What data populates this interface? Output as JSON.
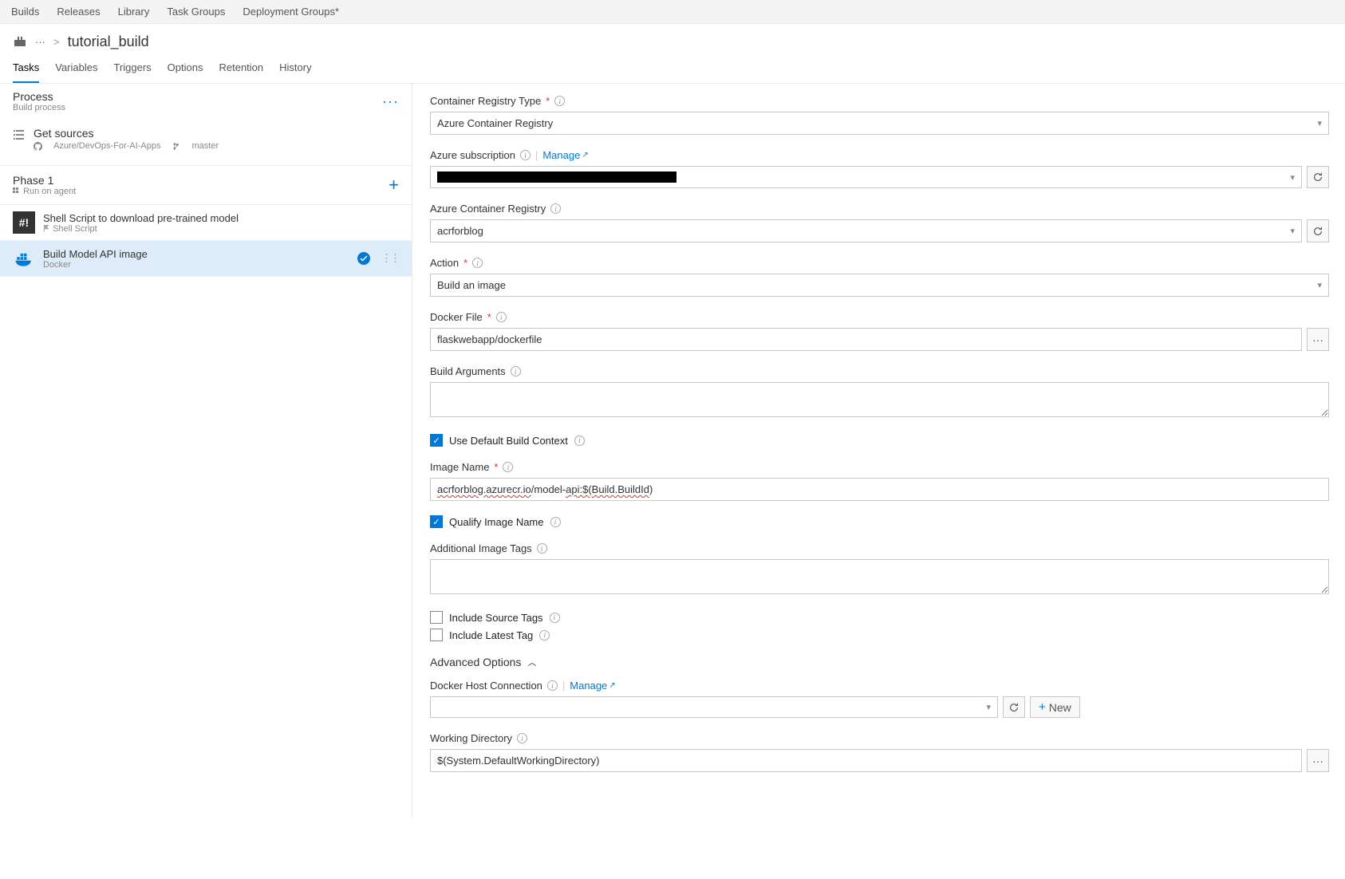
{
  "topNav": {
    "items": [
      "Builds",
      "Releases",
      "Library",
      "Task Groups",
      "Deployment Groups*"
    ]
  },
  "breadcrumb": {
    "dots": "···",
    "chevron": ">",
    "title": "tutorial_build"
  },
  "subTabs": [
    "Tasks",
    "Variables",
    "Triggers",
    "Options",
    "Retention",
    "History"
  ],
  "activeSubTab": 0,
  "process": {
    "title": "Process",
    "subtitle": "Build process",
    "menu": "···"
  },
  "sources": {
    "title": "Get sources",
    "repo": "Azure/DevOps-For-AI-Apps",
    "branch": "master"
  },
  "phase": {
    "title": "Phase 1",
    "subtitle": "Run on agent"
  },
  "tasks": [
    {
      "name": "Shell Script to download pre-trained model",
      "sub": "Shell Script",
      "iconType": "hash",
      "selected": false
    },
    {
      "name": "Build Model API image",
      "sub": "Docker",
      "iconType": "docker",
      "selected": true
    }
  ],
  "form": {
    "containerRegistryType": {
      "label": "Container Registry Type",
      "required": true,
      "value": "Azure Container Registry"
    },
    "azureSubscription": {
      "label": "Azure subscription",
      "manageLink": "Manage",
      "value": "[redacted]"
    },
    "azureContainerRegistry": {
      "label": "Azure Container Registry",
      "value": "acrforblog"
    },
    "action": {
      "label": "Action",
      "required": true,
      "value": "Build an image"
    },
    "dockerFile": {
      "label": "Docker File",
      "required": true,
      "value": "flaskwebapp/dockerfile"
    },
    "buildArguments": {
      "label": "Build Arguments",
      "value": ""
    },
    "useDefaultBuildContext": {
      "label": "Use Default Build Context",
      "checked": true
    },
    "imageName": {
      "label": "Image Name",
      "required": true,
      "value_pre": "acrforblog.azurecr.io",
      "value_mid": "/model-",
      "value_api": "api:$(",
      "value_bid": "Build.BuildId",
      "value_end": ")"
    },
    "qualifyImageName": {
      "label": "Qualify Image Name",
      "checked": true
    },
    "additionalImageTags": {
      "label": "Additional Image Tags",
      "value": ""
    },
    "includeSourceTags": {
      "label": "Include Source Tags",
      "checked": false
    },
    "includeLatestTag": {
      "label": "Include Latest Tag",
      "checked": false
    },
    "advancedHeader": "Advanced Options",
    "dockerHostConnection": {
      "label": "Docker Host Connection",
      "manageLink": "Manage",
      "value": ""
    },
    "workingDirectory": {
      "label": "Working Directory",
      "value": "$(System.DefaultWorkingDirectory)"
    },
    "newButton": "New"
  }
}
